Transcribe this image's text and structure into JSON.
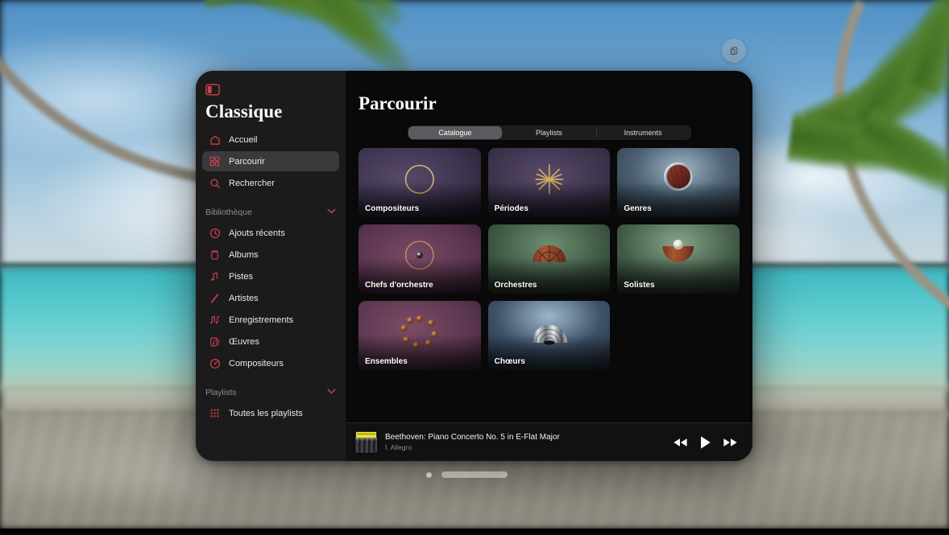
{
  "window_controls": {
    "share_button_icon": "share-rectangle-icon",
    "sidebar_toggle_icon": "sidebar-toggle-icon",
    "resize_handle": "window-resize-handle",
    "recenter_dot": "window-recenter-dot"
  },
  "sidebar": {
    "app_title": "Classique",
    "primary_items": [
      {
        "label": "Accueil",
        "icon": "home-icon",
        "selected": false
      },
      {
        "label": "Parcourir",
        "icon": "grid-icon",
        "selected": true
      },
      {
        "label": "Rechercher",
        "icon": "search-icon",
        "selected": false
      }
    ],
    "library": {
      "title": "Bibliothèque",
      "chevron": "chevron-down-icon",
      "items": [
        {
          "label": "Ajouts récents",
          "icon": "clock-icon"
        },
        {
          "label": "Albums",
          "icon": "album-icon"
        },
        {
          "label": "Pistes",
          "icon": "note-icon"
        },
        {
          "label": "Artistes",
          "icon": "artist-icon"
        },
        {
          "label": "Enregistrements",
          "icon": "double-note-icon"
        },
        {
          "label": "Œuvres",
          "icon": "works-icon"
        },
        {
          "label": "Compositeurs",
          "icon": "composer-icon"
        }
      ]
    },
    "playlists": {
      "title": "Playlists",
      "chevron": "chevron-down-icon",
      "items": [
        {
          "label": "Toutes les playlists",
          "icon": "playlist-grid-icon"
        }
      ]
    }
  },
  "main": {
    "page_title": "Parcourir",
    "tabs": [
      {
        "label": "Catalogue",
        "active": true
      },
      {
        "label": "Playlists",
        "active": false
      },
      {
        "label": "Instruments",
        "active": false
      }
    ],
    "cards": [
      {
        "label": "Compositeurs",
        "art": "gold-ring"
      },
      {
        "label": "Périodes",
        "art": "gold-starburst"
      },
      {
        "label": "Genres",
        "art": "wood-disc-silver-ring"
      },
      {
        "label": "Chefs d'orchestre",
        "art": "gold-ring-small-sphere"
      },
      {
        "label": "Orchestres",
        "art": "wood-fan-semicircle"
      },
      {
        "label": "Solistes",
        "art": "wood-bowl-white-sphere"
      },
      {
        "label": "Ensembles",
        "art": "copper-disc-circle"
      },
      {
        "label": "Chœurs",
        "art": "chrome-dome-arches"
      }
    ]
  },
  "player": {
    "album_art": "deutsche-grammophon-cover",
    "track_title": "Beethoven: Piano Concerto No. 5 in E-Flat Major",
    "track_subtitle": "I. Allegro",
    "controls": [
      {
        "name": "previous-button",
        "icon": "rewind-icon"
      },
      {
        "name": "play-button",
        "icon": "play-icon"
      },
      {
        "name": "next-button",
        "icon": "fast-forward-icon"
      }
    ]
  },
  "colors": {
    "accent": "#c8414b",
    "sidebar_bg": "#1c1b1c",
    "main_bg": "#090909",
    "selected_row": "#3a3a3c",
    "segment_active": "#5b5b5f",
    "text_primary": "#ffffff",
    "text_secondary": "#8d8d92"
  }
}
